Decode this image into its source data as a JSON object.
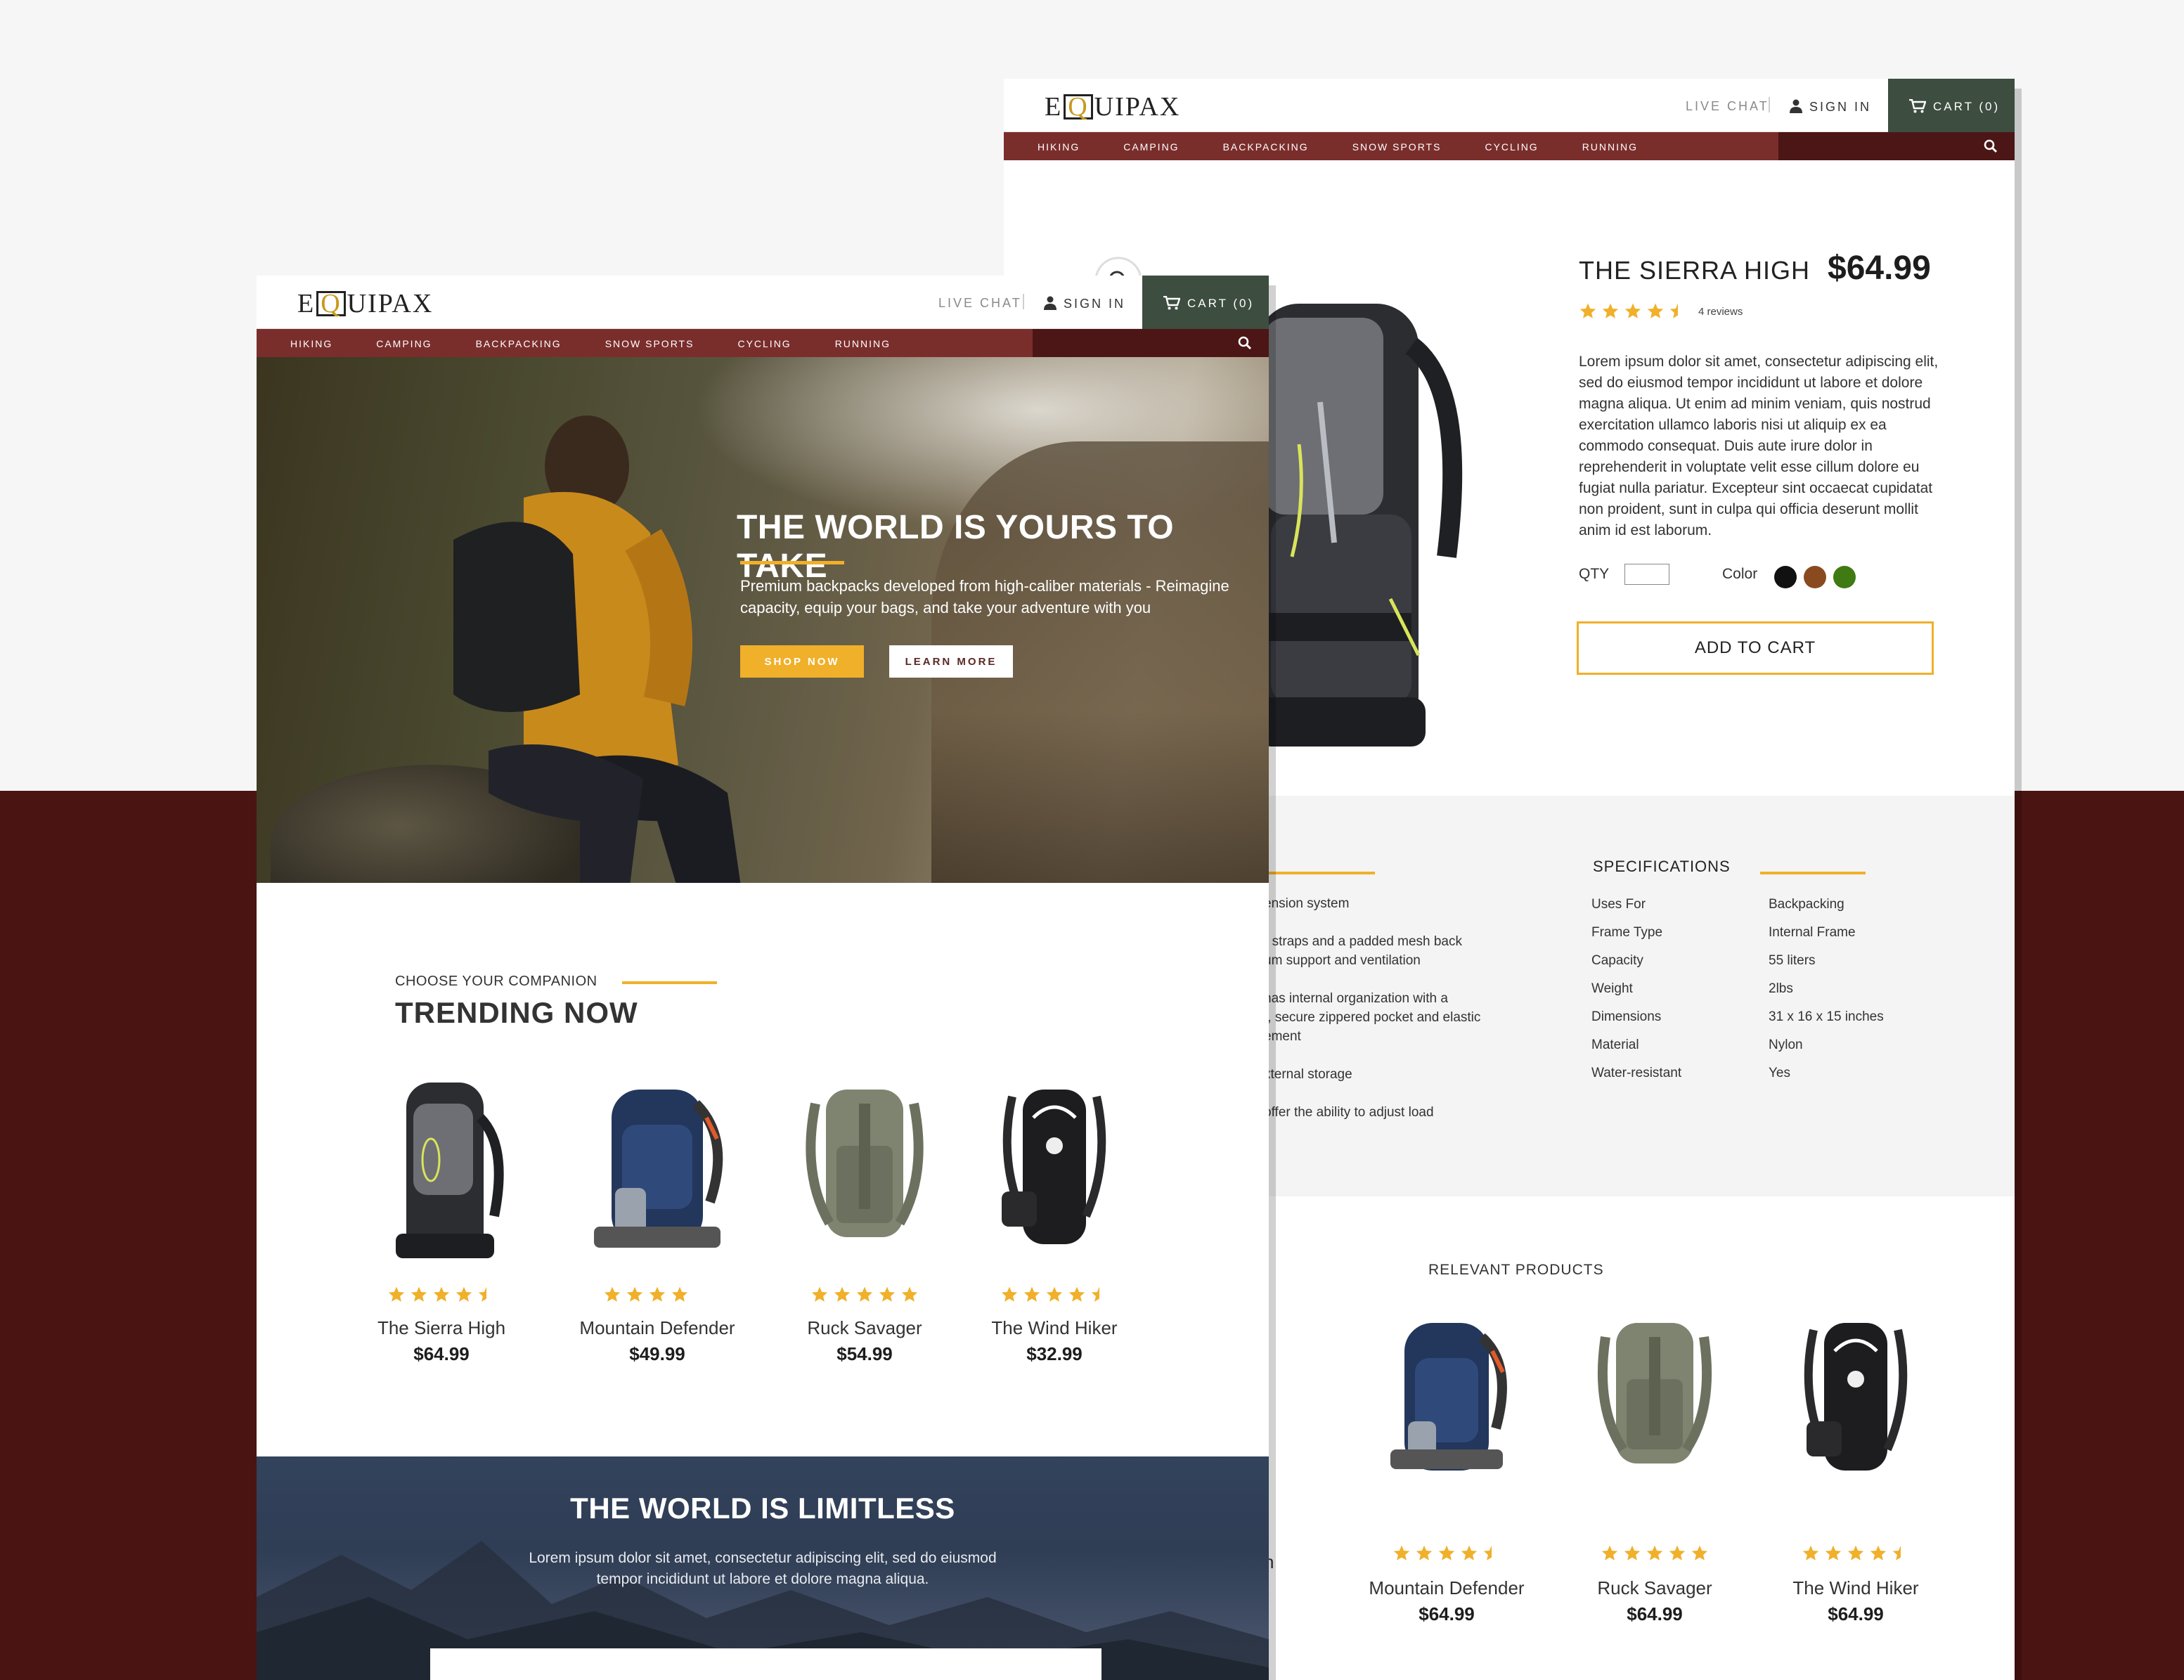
{
  "brand": {
    "logo_prefix": "E",
    "logo_suffix": "UIPAX"
  },
  "header": {
    "live_chat": "LIVE CHAT",
    "sign_in": "SIGN IN",
    "cart": "CART (0)"
  },
  "nav": [
    "HIKING",
    "CAMPING",
    "BACKPACKING",
    "SNOW SPORTS",
    "CYCLING",
    "RUNNING"
  ],
  "home": {
    "hero_title": "THE WORLD IS YOURS TO TAKE",
    "hero_subtitle": "Premium backpacks developed from high-caliber materials - Reimagine capacity, equip your bags, and take your adventure with you",
    "shop_now": "SHOP NOW",
    "learn_more": "LEARN MORE",
    "section_kicker": "CHOOSE YOUR COMPANION",
    "section_title": "TRENDING NOW",
    "products": [
      {
        "name": "The Sierra High",
        "price": "$64.99",
        "rating": 4.5
      },
      {
        "name": "Mountain Defender",
        "price": "$49.99",
        "rating": 4
      },
      {
        "name": "Ruck Savager",
        "price": "$54.99",
        "rating": 5
      },
      {
        "name": "The Wind Hiker",
        "price": "$32.99",
        "rating": 4.5
      }
    ],
    "band_title": "THE WORLD IS LIMITLESS",
    "band_text": "Lorem ipsum dolor sit amet, consectetur adipiscing elit, sed do eiusmod tempor incididunt ut labore et dolore magna aliqua."
  },
  "product": {
    "title": "THE SIERRA HIGH",
    "price": "$64.99",
    "rating": 4.5,
    "reviews": "4 reviews",
    "description": "Lorem ipsum dolor sit amet, consectetur adipiscing elit, sed do eiusmod tempor incididunt ut labore et dolore magna aliqua. Ut enim ad minim veniam, quis nostrud exercitation ullamco laboris nisi ut aliquip ex ea commodo consequat. Duis aute irure dolor in reprehenderit in voluptate velit esse cillum dolore eu fugiat nulla pariatur. Excepteur sint occaecat cupidatat non proident, sunt in culpa qui officia deserunt mollit anim id est laborum.",
    "qty_label": "QTY",
    "qty_value": "",
    "color_label": "Color",
    "colors": [
      "#111111",
      "#8a4a1f",
      "#3f7a12"
    ],
    "add_to_cart": "ADD TO CART",
    "feature_fragments": [
      "ension system",
      "r straps and a padded mesh back",
      "um support and ventilation",
      "has internal organization with a",
      "t, secure zippered pocket and elastic",
      "ement",
      "xternal storage",
      "offer the ability to adjust load"
    ],
    "spec_title": "SPECIFICATIONS",
    "specs": [
      {
        "key": "Uses For",
        "value": "Backpacking"
      },
      {
        "key": "Frame Type",
        "value": "Internal Frame"
      },
      {
        "key": "Capacity",
        "value": "55 liters"
      },
      {
        "key": "Weight",
        "value": "2lbs"
      },
      {
        "key": "Dimensions",
        "value": "31 x 16 x 15 inches"
      },
      {
        "key": "Material",
        "value": "Nylon"
      },
      {
        "key": "Water-resistant",
        "value": "Yes"
      }
    ],
    "relevant_title": "RELEVANT PRODUCTS",
    "relevant_fragment": "h",
    "relevant": [
      {
        "name": "Mountain Defender",
        "price": "$64.99",
        "rating": 4.5
      },
      {
        "name": "Ruck Savager",
        "price": "$64.99",
        "rating": 5
      },
      {
        "name": "The Wind Hiker",
        "price": "$64.99",
        "rating": 4.5
      }
    ]
  },
  "colors": {
    "accent": "#f0b02a",
    "nav": "#7a2e2c",
    "nav_dark": "#4b1615",
    "cart": "#3d4d40",
    "backdrop": "#4a1413"
  },
  "icons": [
    "user-icon",
    "cart-icon",
    "search-icon",
    "star-icon",
    "zoom-icon"
  ]
}
